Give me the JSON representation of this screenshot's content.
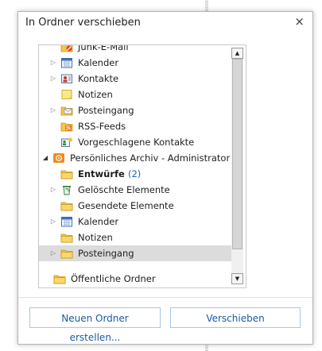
{
  "dialog": {
    "title": "In Ordner verschieben",
    "close_glyph": "×"
  },
  "tree": {
    "items": [
      {
        "label": "Junk-E-Mail",
        "icon": "junk-folder-icon",
        "indent": 1,
        "expander": "none"
      },
      {
        "label": "Kalender",
        "icon": "calendar-icon",
        "indent": 1,
        "expander": "collapsed"
      },
      {
        "label": "Kontakte",
        "icon": "contacts-icon",
        "indent": 1,
        "expander": "collapsed"
      },
      {
        "label": "Notizen",
        "icon": "notes-icon",
        "indent": 1,
        "expander": "none"
      },
      {
        "label": "Posteingang",
        "icon": "inbox-icon",
        "indent": 1,
        "expander": "collapsed"
      },
      {
        "label": "RSS-Feeds",
        "icon": "rss-icon",
        "indent": 1,
        "expander": "none"
      },
      {
        "label": "Vorgeschlagene Kontakte",
        "icon": "suggested-contacts-icon",
        "indent": 1,
        "expander": "none"
      },
      {
        "label": "Persönliches Archiv - Administrator",
        "icon": "archive-icon",
        "indent": 0,
        "expander": "expanded"
      },
      {
        "label": "Entwürfe",
        "count": "(2)",
        "icon": "folder-icon",
        "indent": 1,
        "expander": "none",
        "bold": true
      },
      {
        "label": "Gelöschte Elemente",
        "icon": "recycle-icon",
        "indent": 1,
        "expander": "collapsed"
      },
      {
        "label": "Gesendete Elemente",
        "icon": "folder-icon",
        "indent": 1,
        "expander": "none"
      },
      {
        "label": "Kalender",
        "icon": "calendar-icon",
        "indent": 1,
        "expander": "collapsed"
      },
      {
        "label": "Notizen",
        "icon": "folder-icon",
        "indent": 1,
        "expander": "none"
      },
      {
        "label": "Posteingang",
        "icon": "folder-icon",
        "indent": 1,
        "expander": "collapsed",
        "selected": true
      }
    ],
    "public_folder": "Öffentliche Ordner"
  },
  "buttons": {
    "new_folder": "Neuen Ordner erstellen...",
    "move": "Verschieben"
  },
  "scrollbar": {
    "up_glyph": "▲",
    "down_glyph": "▼"
  },
  "colors": {
    "selection": "#dcdcdc",
    "button_text": "#1a5aa5",
    "count_text": "#1a63b0"
  }
}
